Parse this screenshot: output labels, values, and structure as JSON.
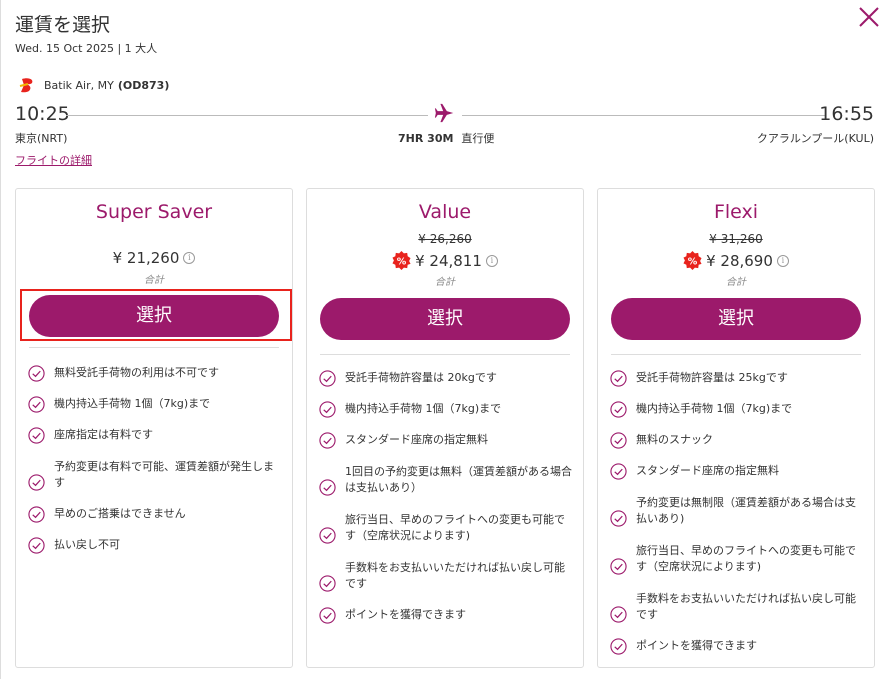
{
  "header": {
    "title": "運賃を選択",
    "subtitle": "Wed. 15 Oct 2025 | 1 大人",
    "close_icon": "close-icon"
  },
  "flight": {
    "airline": "Batik Air, MY",
    "flight_no": "(OD873)",
    "dep_time": "10:25",
    "arr_time": "16:55",
    "dep_city": "東京(NRT)",
    "arr_city": "クアラルンプール(KUL)",
    "duration": "7HR 30M",
    "stops": "直行便",
    "details_link": "フライトの詳細"
  },
  "colors": {
    "brand": "#9c1a6b",
    "highlight": "#e8231d",
    "discount_badge": "#e8231d"
  },
  "fares": [
    {
      "name": "Super Saver",
      "old_price": "",
      "price": "¥ 21,260",
      "total_label": "合計",
      "button": "選択",
      "features": [
        "無料受託手荷物の利用は不可です",
        "機内持込手荷物 1個（7kg)まで",
        "座席指定は有料です",
        "予約変更は有料で可能、運賃差額が発生します",
        "早めのご搭乗はできません",
        "払い戻し不可"
      ]
    },
    {
      "name": "Value",
      "old_price": "¥ 26,260",
      "price": "¥ 24,811",
      "total_label": "合計",
      "button": "選択",
      "features": [
        "受託手荷物許容量は 20kgです",
        "機内持込手荷物 1個（7kg)まで",
        "スタンダード座席の指定無料",
        "1回目の予約変更は無料（運賃差額がある場合は支払いあり）",
        "旅行当日、早めのフライトへの変更も可能です（空席状況によります)",
        "手数料をお支払いいただければ払い戻し可能です",
        "ポイントを獲得できます"
      ]
    },
    {
      "name": "Flexi",
      "old_price": "¥ 31,260",
      "price": "¥ 28,690",
      "total_label": "合計",
      "button": "選択",
      "features": [
        "受託手荷物許容量は 25kgです",
        "機内持込手荷物 1個（7kg)まで",
        "無料のスナック",
        "スタンダード座席の指定無料",
        "予約変更は無制限（運賃差額がある場合は支払いあり)",
        "旅行当日、早めのフライトへの変更も可能です（空席状況によります)",
        "手数料をお支払いいただければ払い戻し可能です",
        "ポイントを獲得できます"
      ]
    }
  ]
}
